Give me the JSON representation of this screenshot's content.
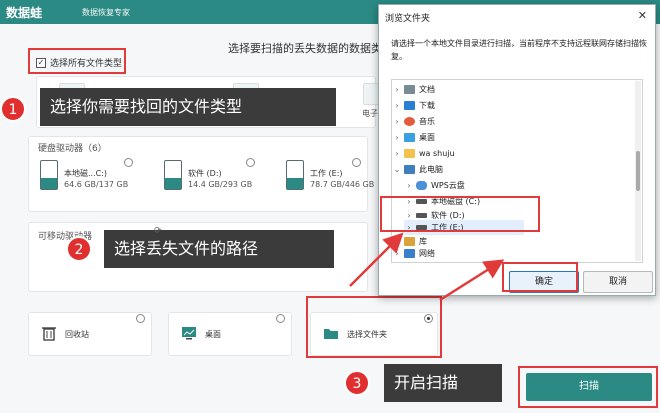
{
  "app": {
    "logo": "数据蛙",
    "tagline": "数据恢复专家"
  },
  "main": {
    "heading": "选择要扫描的丢失数据的数据类",
    "select_all": "选择所有文件类型",
    "other_type_label": "电子",
    "hdd_section": "硬盘驱动器（6）",
    "drives": [
      {
        "name": "本地磁...C:)",
        "size": "64.6 GB/137 GB"
      },
      {
        "name": "软件 (D:)",
        "size": "14.4 GB/293 GB"
      },
      {
        "name": "工作 (E:)",
        "size": "78.7 GB/446 GB"
      }
    ],
    "removable_section": "可移动驱动器",
    "locations": [
      {
        "label": "回收站"
      },
      {
        "label": "桌面"
      },
      {
        "label": "选择文件夹"
      }
    ],
    "scan_button": "扫描"
  },
  "callouts": [
    {
      "num": "1",
      "text": "选择你需要找回的文件类型"
    },
    {
      "num": "2",
      "text": "选择丢失文件的路径"
    },
    {
      "num": "3",
      "text": "开启扫描"
    }
  ],
  "dialog": {
    "title": "浏览文件夹",
    "close": "✕",
    "description": "请选择一个本地文件目录进行扫描，当前程序不支持远程联网存储扫描恢复。",
    "tree": [
      {
        "label": "文档"
      },
      {
        "label": "下载"
      },
      {
        "label": "音乐"
      },
      {
        "label": "桌面"
      },
      {
        "label": "wa shuju"
      },
      {
        "label": "此电脑"
      },
      {
        "label": "WPS云盘"
      },
      {
        "label": "本地磁盘 (C:)"
      },
      {
        "label": "软件 (D:)"
      },
      {
        "label": "工作 (E:)"
      },
      {
        "label": "库"
      },
      {
        "label": "网络"
      }
    ],
    "ok": "确定",
    "cancel": "取消"
  },
  "colors": {
    "accent": "#2b8a84",
    "highlight_red": "#e03a3a",
    "callout_bg": "#3b3b3b"
  }
}
